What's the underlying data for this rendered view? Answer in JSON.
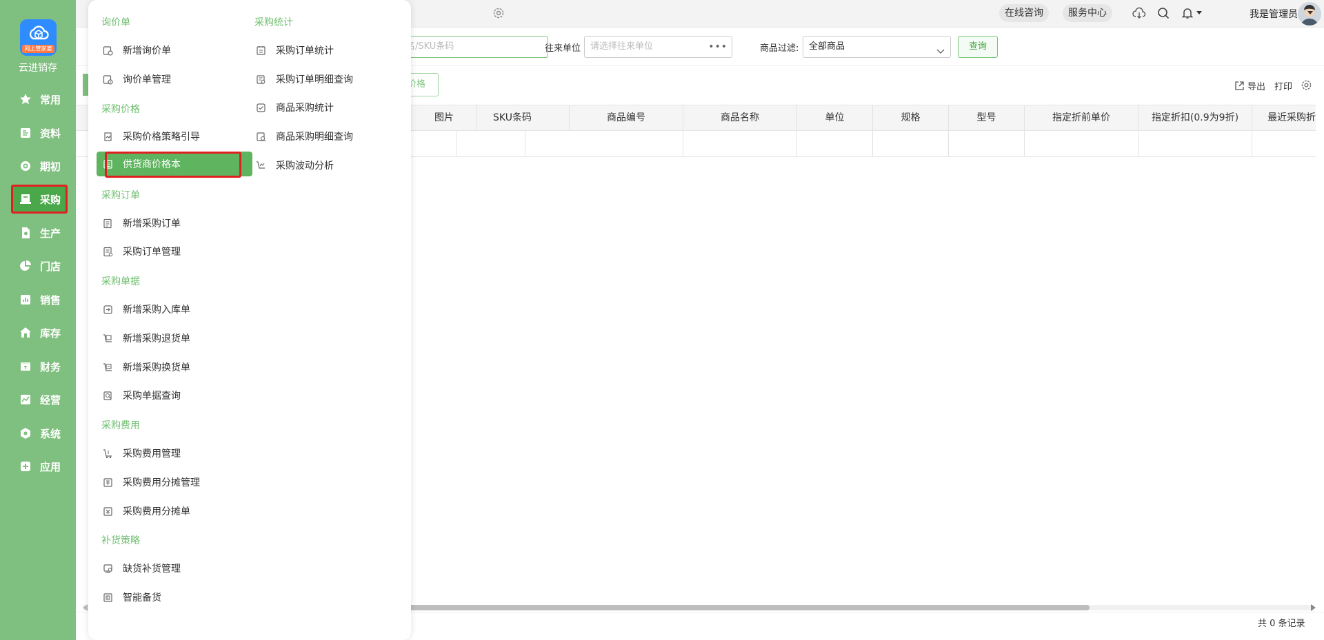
{
  "app": {
    "brand": "云进销存",
    "logo_badge": "网上管家婆",
    "accent_color": "#7fbf7f",
    "active_color": "#4aa84a",
    "highlight_color": "#e02020"
  },
  "sidebar": {
    "items": [
      {
        "label": "常用",
        "icon": "star-icon"
      },
      {
        "label": "资料",
        "icon": "document-icon"
      },
      {
        "label": "期初",
        "icon": "target-icon"
      },
      {
        "label": "采购",
        "icon": "purchase-icon",
        "active": true
      },
      {
        "label": "生产",
        "icon": "production-icon"
      },
      {
        "label": "门店",
        "icon": "pie-icon"
      },
      {
        "label": "销售",
        "icon": "sales-icon"
      },
      {
        "label": "库存",
        "icon": "home-icon"
      },
      {
        "label": "财务",
        "icon": "finance-icon"
      },
      {
        "label": "经营",
        "icon": "chart-icon"
      },
      {
        "label": "系统",
        "icon": "gear-icon"
      },
      {
        "label": "应用",
        "icon": "plus-icon"
      }
    ]
  },
  "topbar": {
    "online_consult": "在线咨询",
    "service_center": "服务中心",
    "user_name": "我是管理员"
  },
  "filters": {
    "search_placeholder": "名/SKU条码",
    "partner_label": "往来单位",
    "partner_placeholder": "请选择往来单位",
    "product_filter_label": "商品过滤:",
    "product_filter_value": "全部商品",
    "query_button": "查询"
  },
  "toolbar": {
    "price_button": "价格",
    "export": "导出",
    "print": "打印"
  },
  "table": {
    "columns": [
      "图片",
      "SKU条码",
      "商品编号",
      "商品名称",
      "单位",
      "规格",
      "型号",
      "指定折前单价",
      "指定折扣(0.9为9折)",
      "最近采购折"
    ],
    "footer": "共 0 条记录"
  },
  "menu": {
    "left_column": [
      {
        "type": "header",
        "label": "询价单"
      },
      {
        "type": "item",
        "label": "新增询价单",
        "icon": "inquiry-add-icon"
      },
      {
        "type": "item",
        "label": "询价单管理",
        "icon": "inquiry-manage-icon"
      },
      {
        "type": "header",
        "label": "采购价格"
      },
      {
        "type": "item",
        "label": "采购价格策略引导",
        "icon": "price-guide-icon"
      },
      {
        "type": "item",
        "label": "供货商价格本",
        "icon": "price-book-icon",
        "selected": true
      },
      {
        "type": "header",
        "label": "采购订单"
      },
      {
        "type": "item",
        "label": "新增采购订单",
        "icon": "order-add-icon"
      },
      {
        "type": "item",
        "label": "采购订单管理",
        "icon": "order-manage-icon"
      },
      {
        "type": "header",
        "label": "采购单据"
      },
      {
        "type": "item",
        "label": "新增采购入库单",
        "icon": "stock-in-icon"
      },
      {
        "type": "item",
        "label": "新增采购退货单",
        "icon": "return-icon"
      },
      {
        "type": "item",
        "label": "新增采购换货单",
        "icon": "exchange-icon"
      },
      {
        "type": "item",
        "label": "采购单据查询",
        "icon": "doc-search-icon"
      },
      {
        "type": "header",
        "label": "采购费用"
      },
      {
        "type": "item",
        "label": "采购费用管理",
        "icon": "expense-icon"
      },
      {
        "type": "item",
        "label": "采购费用分摊管理",
        "icon": "expense-split-icon"
      },
      {
        "type": "item",
        "label": "采购费用分摊单",
        "icon": "expense-bill-icon"
      },
      {
        "type": "header",
        "label": "补货策略"
      },
      {
        "type": "item",
        "label": "缺货补货管理",
        "icon": "restock-icon"
      },
      {
        "type": "item",
        "label": "智能备货",
        "icon": "smart-stock-icon"
      }
    ],
    "right_column": [
      {
        "type": "header",
        "label": "采购统计"
      },
      {
        "type": "item",
        "label": "采购订单统计",
        "icon": "order-stats-icon"
      },
      {
        "type": "item",
        "label": "采购订单明细查询",
        "icon": "order-detail-icon"
      },
      {
        "type": "item",
        "label": "商品采购统计",
        "icon": "product-stats-icon"
      },
      {
        "type": "item",
        "label": "商品采购明细查询",
        "icon": "product-detail-icon"
      },
      {
        "type": "item",
        "label": "采购波动分析",
        "icon": "fluctuation-icon"
      }
    ]
  }
}
